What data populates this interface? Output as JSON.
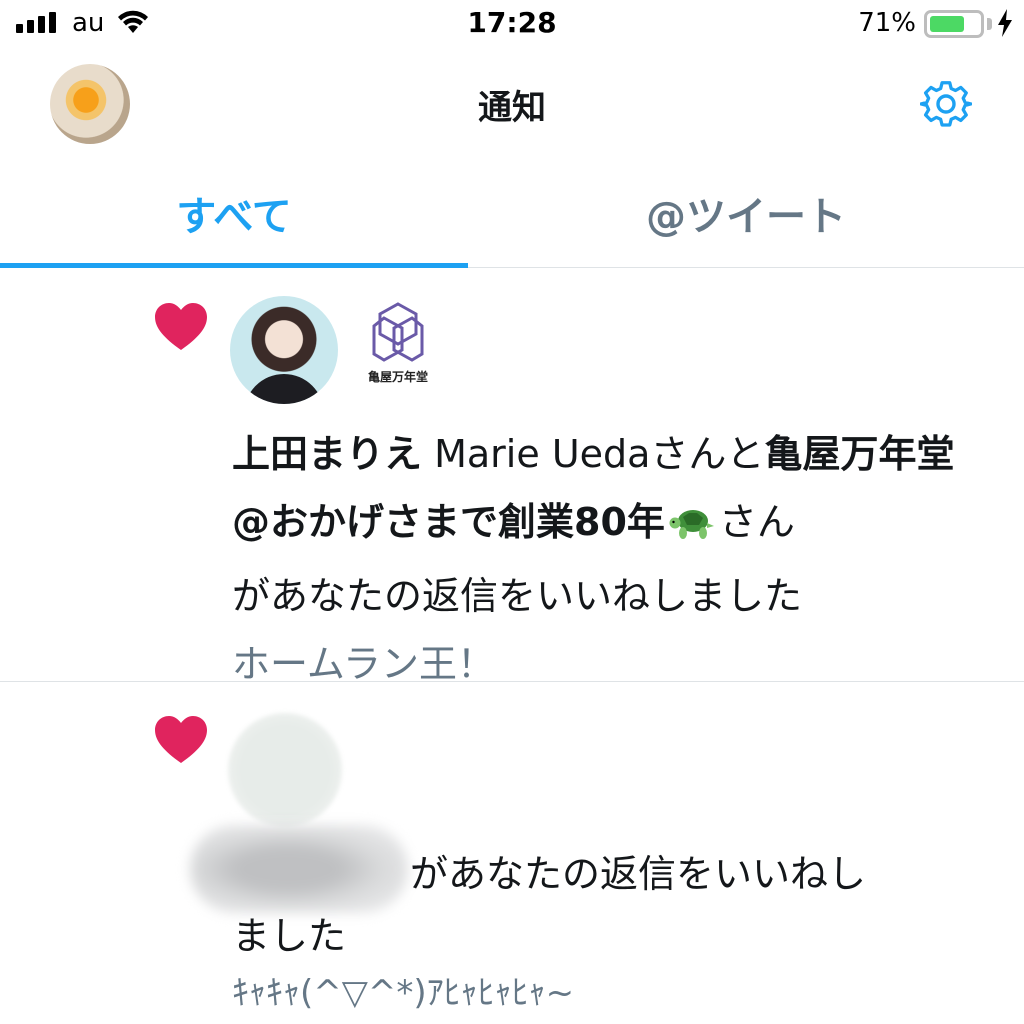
{
  "status_bar": {
    "carrier": "au",
    "time": "17:28",
    "battery_percent_label": "71%",
    "battery_level": 0.71,
    "battery_color": "#4cd964",
    "icons": [
      "signal-icon",
      "wifi-icon",
      "battery-icon",
      "charging-bolt-icon"
    ]
  },
  "header": {
    "title": "通知",
    "profile_avatar": "self-avatar",
    "settings_icon": "gear-icon"
  },
  "tabs": [
    {
      "label": "すべて",
      "active": true
    },
    {
      "label": "@ツイート",
      "active": false
    }
  ],
  "colors": {
    "accent": "#1da1f2",
    "heart": "#e0245e",
    "secondary_text": "#657786"
  },
  "notifications": [
    {
      "icon": "heart-icon",
      "avatars": [
        "marie-ueda-avatar",
        "kameya-mannendo-avatar"
      ],
      "kameya_logo_text": "亀屋万年堂",
      "user1_name": "上田まりえ",
      "user1_latin": "Marie Ueda",
      "connector": "さんと",
      "user2_name": "亀屋万年堂@おかげさまで創業80年",
      "user2_emoji": "turtle-icon",
      "san": "さん",
      "action": "があなたの返信をいいねしました",
      "snippet": "ホームラン王！"
    },
    {
      "icon": "heart-icon",
      "avatars": [
        "blurred-avatar"
      ],
      "action_line1": "があなたの返信をいいねし",
      "action_line2": "ました",
      "snippet": "ｷｬｷｬ(^▽^*)ｱﾋｬﾋｬﾋｬ~"
    }
  ]
}
